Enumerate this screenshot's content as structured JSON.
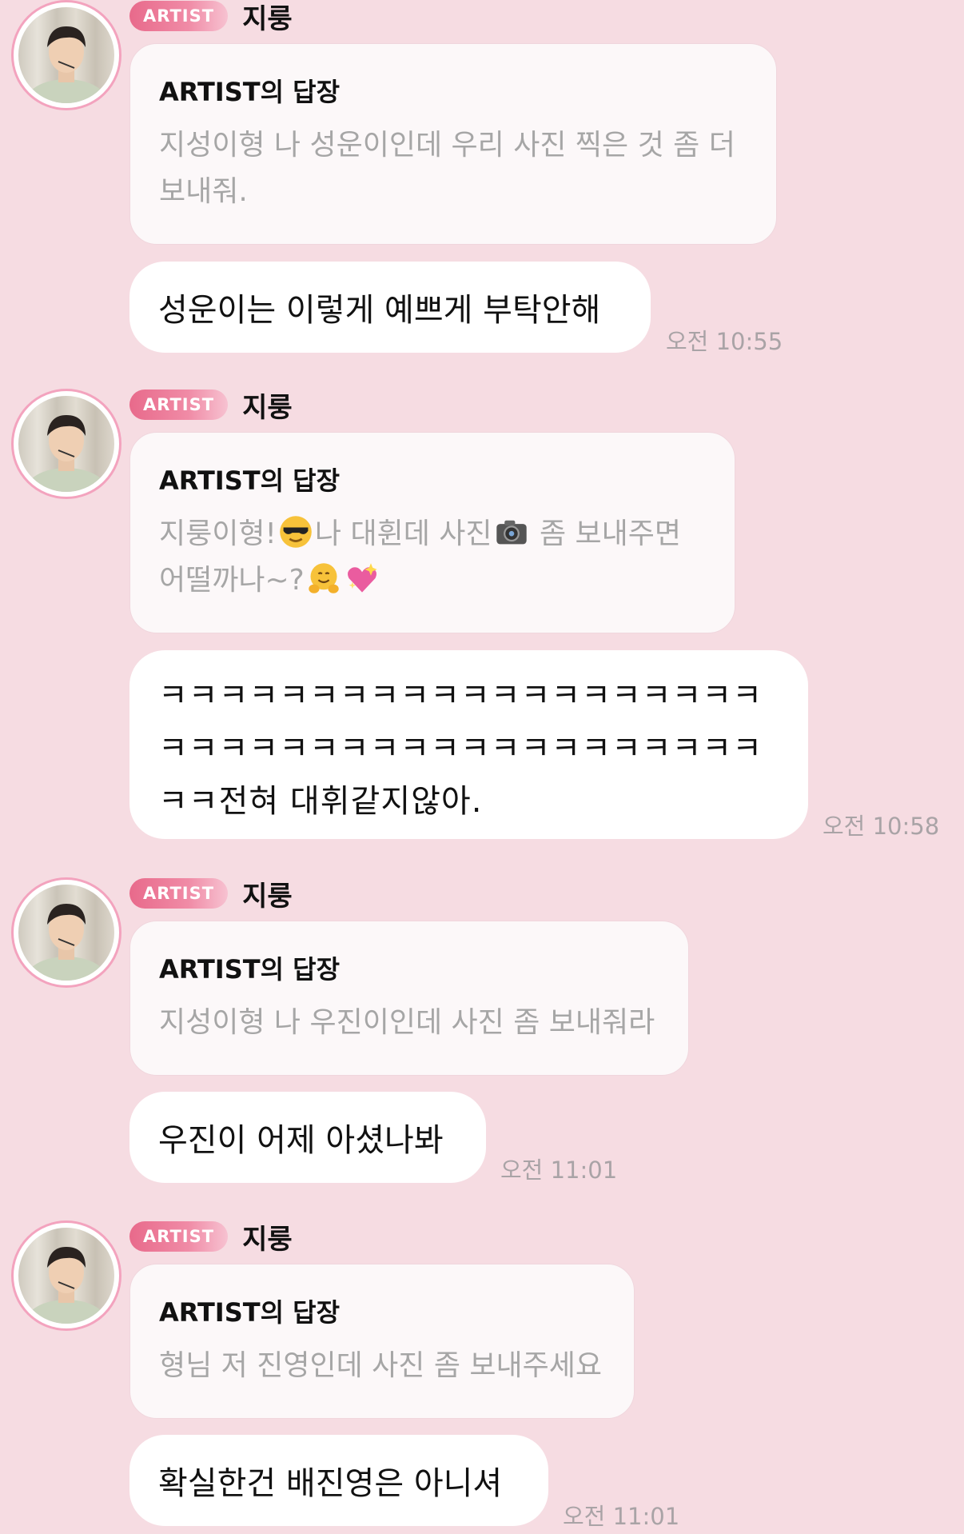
{
  "badge_label": "ARTIST",
  "artist_name": "지룽",
  "reply_title": "ARTIST의 답장",
  "colors": {
    "background": "#f6dce2",
    "badge": "#e86a8b",
    "reply_card": "#fcf8f9",
    "bubble": "#ffffff",
    "reply_text": "#a6a6a6",
    "timestamp": "#a9a3a6"
  },
  "messages": [
    {
      "reply_line1": "지성이형 나 성운이인데 우리 사진 찍은 것 좀 더",
      "reply_line2": "보내줘.",
      "bubble_text": "성운이는 이렇게 예쁘게 부탁안해",
      "time": "오전 10:55"
    },
    {
      "reply_part1": "지룽이형!",
      "reply_part2": "나 대휜데 사진",
      "reply_part3": " 좀 보내주면",
      "reply_part4": "어떨까나~?",
      "emojis": [
        "sunglasses-emoji",
        "camera-emoji",
        "hugging-emoji",
        "sparkling-heart-emoji"
      ],
      "bubble_line1": "ㅋㅋㅋㅋㅋㅋㅋㅋㅋㅋㅋㅋㅋㅋㅋㅋㅋㅋㅋㅋ",
      "bubble_line2": "ㅋㅋㅋㅋㅋㅋㅋㅋㅋㅋㅋㅋㅋㅋㅋㅋㅋㅋㅋㅋ",
      "bubble_line3": "ㅋㅋ전혀 대휘같지않아.",
      "time": "오전 10:58"
    },
    {
      "reply_line1": "지성이형 나 우진이인데 사진 좀 보내줘라",
      "bubble_text": "우진이 어제 아셨나봐",
      "time": "오전 11:01"
    },
    {
      "reply_line1": "형님 저 진영인데 사진 좀 보내주세요",
      "bubble_text": "확실한건 배진영은 아니셔",
      "time": "오전 11:01"
    }
  ]
}
